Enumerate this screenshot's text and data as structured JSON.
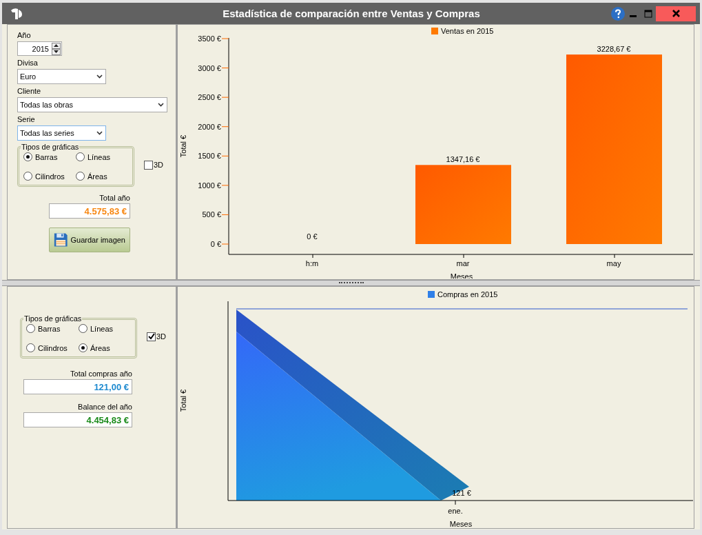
{
  "window": {
    "title": "Estadística de comparación entre Ventas y Compras"
  },
  "sales": {
    "year_label": "Año",
    "year": "2015",
    "currency_label": "Divisa",
    "currency": "Euro",
    "client_label": "Cliente",
    "client": "Todas las obras",
    "series_label": "Serie",
    "series": "Todas las series",
    "chart_types": {
      "title": "Tipos de gráficas",
      "options": [
        {
          "label": "Barras",
          "selected": true
        },
        {
          "label": "Líneas",
          "selected": false
        },
        {
          "label": "Cilindros",
          "selected": false
        },
        {
          "label": "Áreas",
          "selected": false
        }
      ]
    },
    "three_d": {
      "label": "3D",
      "checked": false
    },
    "total_label": "Total año",
    "total": "4.575,83 €",
    "save_button": "Guardar imagen",
    "chart_data": {
      "type": "bar",
      "xlabel": "Meses",
      "ylabel": "Total €",
      "categories": [
        "h:m",
        "mar",
        "may"
      ],
      "series": [
        {
          "name": "Ventas en 2015",
          "color": "#ff7a00",
          "values": [
            0,
            1347.16,
            3228.67
          ]
        }
      ],
      "ylim": [
        0,
        3500
      ],
      "yticks": [
        {
          "value": 0,
          "label": "0 €"
        },
        {
          "value": 500,
          "label": "500 €"
        },
        {
          "value": 1000,
          "label": "1000 €"
        },
        {
          "value": 1500,
          "label": "1500 €"
        },
        {
          "value": 2000,
          "label": "2000 €"
        },
        {
          "value": 2500,
          "label": "2500 €"
        },
        {
          "value": 3000,
          "label": "3000 €"
        },
        {
          "value": 3500,
          "label": "3500 €"
        }
      ],
      "value_labels": [
        "0 €",
        "1347,16 €",
        "3228,67 €"
      ]
    }
  },
  "purchases": {
    "chart_types": {
      "title": "Tipos de gráficas",
      "options": [
        {
          "label": "Barras",
          "selected": false
        },
        {
          "label": "Líneas",
          "selected": false
        },
        {
          "label": "Cilindros",
          "selected": false
        },
        {
          "label": "Áreas",
          "selected": true
        }
      ]
    },
    "three_d": {
      "label": "3D",
      "checked": true
    },
    "total_label": "Total compras año",
    "total": "121,00 €",
    "balance_label": "Balance del año",
    "balance": "4.454,83 €",
    "chart": {
      "legend": "Compras en 2015",
      "xlabel": "Meses",
      "ylabel": "Total €",
      "category": "ene.",
      "value_label": "121 €"
    }
  }
}
